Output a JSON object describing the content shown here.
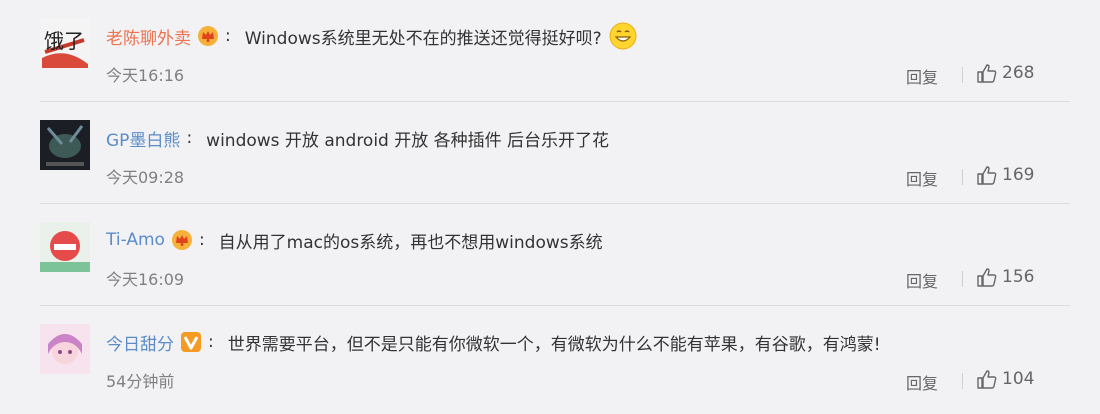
{
  "comments": [
    {
      "username": "老陈聊外卖",
      "text": "Windows系统里无处不在的推送还觉得挺好呗?",
      "time": "今天16:16",
      "reply_label": "回复",
      "likes": "268",
      "avatar_caption": "饿了"
    },
    {
      "username": "GP墨白熊",
      "text": "windows 开放 android 开放 各种插件 后台乐开了花",
      "time": "今天09:28",
      "reply_label": "回复",
      "likes": "169"
    },
    {
      "username": "Ti-Amo",
      "text": "自从用了mac的os系统，再也不想用windows系统",
      "time": "今天16:09",
      "reply_label": "回复",
      "likes": "156"
    },
    {
      "username": "今日甜分",
      "text": "世界需要平台，但不是只能有你微软一个，有微软为什么不能有苹果，有谷歌，有鸿蒙!",
      "time": "54分钟前",
      "reply_label": "回复",
      "likes": "104"
    }
  ],
  "colors": {
    "background": "#f2f2f5",
    "username_orange": "#eb7350",
    "username_blue": "#5b8cc7",
    "text": "#333333",
    "meta": "#808080"
  }
}
